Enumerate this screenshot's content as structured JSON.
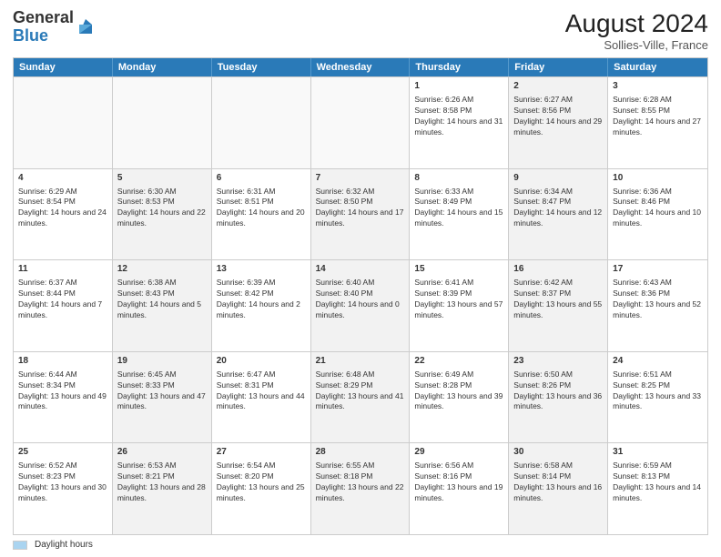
{
  "header": {
    "logo_general": "General",
    "logo_blue": "Blue",
    "month_year": "August 2024",
    "location": "Sollies-Ville, France"
  },
  "days_of_week": [
    "Sunday",
    "Monday",
    "Tuesday",
    "Wednesday",
    "Thursday",
    "Friday",
    "Saturday"
  ],
  "weeks": [
    [
      {
        "day": "",
        "sunrise": "",
        "sunset": "",
        "daylight": "",
        "shaded": false,
        "empty": true
      },
      {
        "day": "",
        "sunrise": "",
        "sunset": "",
        "daylight": "",
        "shaded": false,
        "empty": true
      },
      {
        "day": "",
        "sunrise": "",
        "sunset": "",
        "daylight": "",
        "shaded": false,
        "empty": true
      },
      {
        "day": "",
        "sunrise": "",
        "sunset": "",
        "daylight": "",
        "shaded": false,
        "empty": true
      },
      {
        "day": "1",
        "sunrise": "Sunrise: 6:26 AM",
        "sunset": "Sunset: 8:58 PM",
        "daylight": "Daylight: 14 hours and 31 minutes.",
        "shaded": false,
        "empty": false
      },
      {
        "day": "2",
        "sunrise": "Sunrise: 6:27 AM",
        "sunset": "Sunset: 8:56 PM",
        "daylight": "Daylight: 14 hours and 29 minutes.",
        "shaded": true,
        "empty": false
      },
      {
        "day": "3",
        "sunrise": "Sunrise: 6:28 AM",
        "sunset": "Sunset: 8:55 PM",
        "daylight": "Daylight: 14 hours and 27 minutes.",
        "shaded": false,
        "empty": false
      }
    ],
    [
      {
        "day": "4",
        "sunrise": "Sunrise: 6:29 AM",
        "sunset": "Sunset: 8:54 PM",
        "daylight": "Daylight: 14 hours and 24 minutes.",
        "shaded": false,
        "empty": false
      },
      {
        "day": "5",
        "sunrise": "Sunrise: 6:30 AM",
        "sunset": "Sunset: 8:53 PM",
        "daylight": "Daylight: 14 hours and 22 minutes.",
        "shaded": true,
        "empty": false
      },
      {
        "day": "6",
        "sunrise": "Sunrise: 6:31 AM",
        "sunset": "Sunset: 8:51 PM",
        "daylight": "Daylight: 14 hours and 20 minutes.",
        "shaded": false,
        "empty": false
      },
      {
        "day": "7",
        "sunrise": "Sunrise: 6:32 AM",
        "sunset": "Sunset: 8:50 PM",
        "daylight": "Daylight: 14 hours and 17 minutes.",
        "shaded": true,
        "empty": false
      },
      {
        "day": "8",
        "sunrise": "Sunrise: 6:33 AM",
        "sunset": "Sunset: 8:49 PM",
        "daylight": "Daylight: 14 hours and 15 minutes.",
        "shaded": false,
        "empty": false
      },
      {
        "day": "9",
        "sunrise": "Sunrise: 6:34 AM",
        "sunset": "Sunset: 8:47 PM",
        "daylight": "Daylight: 14 hours and 12 minutes.",
        "shaded": true,
        "empty": false
      },
      {
        "day": "10",
        "sunrise": "Sunrise: 6:36 AM",
        "sunset": "Sunset: 8:46 PM",
        "daylight": "Daylight: 14 hours and 10 minutes.",
        "shaded": false,
        "empty": false
      }
    ],
    [
      {
        "day": "11",
        "sunrise": "Sunrise: 6:37 AM",
        "sunset": "Sunset: 8:44 PM",
        "daylight": "Daylight: 14 hours and 7 minutes.",
        "shaded": false,
        "empty": false
      },
      {
        "day": "12",
        "sunrise": "Sunrise: 6:38 AM",
        "sunset": "Sunset: 8:43 PM",
        "daylight": "Daylight: 14 hours and 5 minutes.",
        "shaded": true,
        "empty": false
      },
      {
        "day": "13",
        "sunrise": "Sunrise: 6:39 AM",
        "sunset": "Sunset: 8:42 PM",
        "daylight": "Daylight: 14 hours and 2 minutes.",
        "shaded": false,
        "empty": false
      },
      {
        "day": "14",
        "sunrise": "Sunrise: 6:40 AM",
        "sunset": "Sunset: 8:40 PM",
        "daylight": "Daylight: 14 hours and 0 minutes.",
        "shaded": true,
        "empty": false
      },
      {
        "day": "15",
        "sunrise": "Sunrise: 6:41 AM",
        "sunset": "Sunset: 8:39 PM",
        "daylight": "Daylight: 13 hours and 57 minutes.",
        "shaded": false,
        "empty": false
      },
      {
        "day": "16",
        "sunrise": "Sunrise: 6:42 AM",
        "sunset": "Sunset: 8:37 PM",
        "daylight": "Daylight: 13 hours and 55 minutes.",
        "shaded": true,
        "empty": false
      },
      {
        "day": "17",
        "sunrise": "Sunrise: 6:43 AM",
        "sunset": "Sunset: 8:36 PM",
        "daylight": "Daylight: 13 hours and 52 minutes.",
        "shaded": false,
        "empty": false
      }
    ],
    [
      {
        "day": "18",
        "sunrise": "Sunrise: 6:44 AM",
        "sunset": "Sunset: 8:34 PM",
        "daylight": "Daylight: 13 hours and 49 minutes.",
        "shaded": false,
        "empty": false
      },
      {
        "day": "19",
        "sunrise": "Sunrise: 6:45 AM",
        "sunset": "Sunset: 8:33 PM",
        "daylight": "Daylight: 13 hours and 47 minutes.",
        "shaded": true,
        "empty": false
      },
      {
        "day": "20",
        "sunrise": "Sunrise: 6:47 AM",
        "sunset": "Sunset: 8:31 PM",
        "daylight": "Daylight: 13 hours and 44 minutes.",
        "shaded": false,
        "empty": false
      },
      {
        "day": "21",
        "sunrise": "Sunrise: 6:48 AM",
        "sunset": "Sunset: 8:29 PM",
        "daylight": "Daylight: 13 hours and 41 minutes.",
        "shaded": true,
        "empty": false
      },
      {
        "day": "22",
        "sunrise": "Sunrise: 6:49 AM",
        "sunset": "Sunset: 8:28 PM",
        "daylight": "Daylight: 13 hours and 39 minutes.",
        "shaded": false,
        "empty": false
      },
      {
        "day": "23",
        "sunrise": "Sunrise: 6:50 AM",
        "sunset": "Sunset: 8:26 PM",
        "daylight": "Daylight: 13 hours and 36 minutes.",
        "shaded": true,
        "empty": false
      },
      {
        "day": "24",
        "sunrise": "Sunrise: 6:51 AM",
        "sunset": "Sunset: 8:25 PM",
        "daylight": "Daylight: 13 hours and 33 minutes.",
        "shaded": false,
        "empty": false
      }
    ],
    [
      {
        "day": "25",
        "sunrise": "Sunrise: 6:52 AM",
        "sunset": "Sunset: 8:23 PM",
        "daylight": "Daylight: 13 hours and 30 minutes.",
        "shaded": false,
        "empty": false
      },
      {
        "day": "26",
        "sunrise": "Sunrise: 6:53 AM",
        "sunset": "Sunset: 8:21 PM",
        "daylight": "Daylight: 13 hours and 28 minutes.",
        "shaded": true,
        "empty": false
      },
      {
        "day": "27",
        "sunrise": "Sunrise: 6:54 AM",
        "sunset": "Sunset: 8:20 PM",
        "daylight": "Daylight: 13 hours and 25 minutes.",
        "shaded": false,
        "empty": false
      },
      {
        "day": "28",
        "sunrise": "Sunrise: 6:55 AM",
        "sunset": "Sunset: 8:18 PM",
        "daylight": "Daylight: 13 hours and 22 minutes.",
        "shaded": true,
        "empty": false
      },
      {
        "day": "29",
        "sunrise": "Sunrise: 6:56 AM",
        "sunset": "Sunset: 8:16 PM",
        "daylight": "Daylight: 13 hours and 19 minutes.",
        "shaded": false,
        "empty": false
      },
      {
        "day": "30",
        "sunrise": "Sunrise: 6:58 AM",
        "sunset": "Sunset: 8:14 PM",
        "daylight": "Daylight: 13 hours and 16 minutes.",
        "shaded": true,
        "empty": false
      },
      {
        "day": "31",
        "sunrise": "Sunrise: 6:59 AM",
        "sunset": "Sunset: 8:13 PM",
        "daylight": "Daylight: 13 hours and 14 minutes.",
        "shaded": false,
        "empty": false
      }
    ]
  ],
  "footer": {
    "legend_label": "Daylight hours"
  }
}
